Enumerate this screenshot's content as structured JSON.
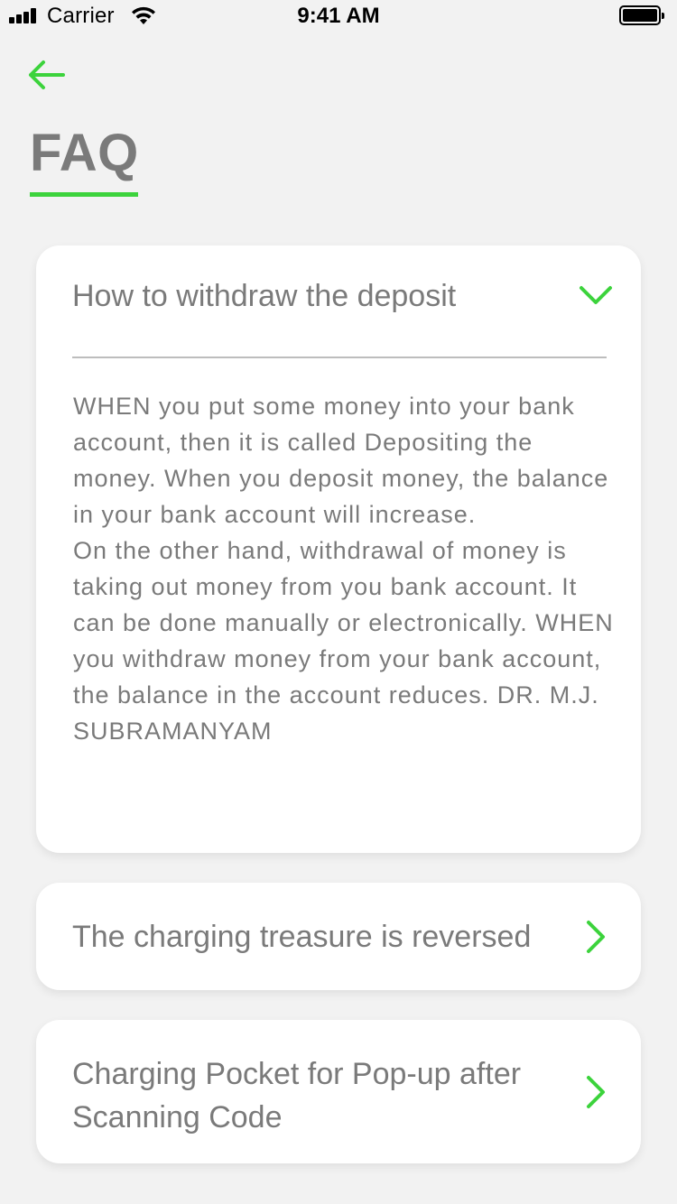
{
  "status_bar": {
    "carrier": "Carrier",
    "time": "9:41 AM"
  },
  "header": {
    "back_icon": "arrow-left-icon",
    "title": "FAQ"
  },
  "colors": {
    "accent": "#3cd33c",
    "text": "#7a7a7a",
    "background": "#f2f2f2",
    "card": "#ffffff"
  },
  "faq": [
    {
      "question": "How to withdraw the deposit",
      "expanded": true,
      "icon": "chevron-down-icon",
      "answer": "WHEN you put some money into your bank account, then it is called Depositing the money. When you deposit money, the balance in your bank account will increase.\nOn the other hand, withdrawal of money is taking out money from you bank account. It can be done manually or electronically. WHEN you withdraw money from your bank account, the balance in the account reduces. DR. M.J. SUBRAMANYAM"
    },
    {
      "question": "The charging treasure is reversed",
      "expanded": false,
      "icon": "chevron-right-icon"
    },
    {
      "question": "Charging Pocket for Pop-up after Scanning Code",
      "expanded": false,
      "icon": "chevron-right-icon"
    }
  ]
}
